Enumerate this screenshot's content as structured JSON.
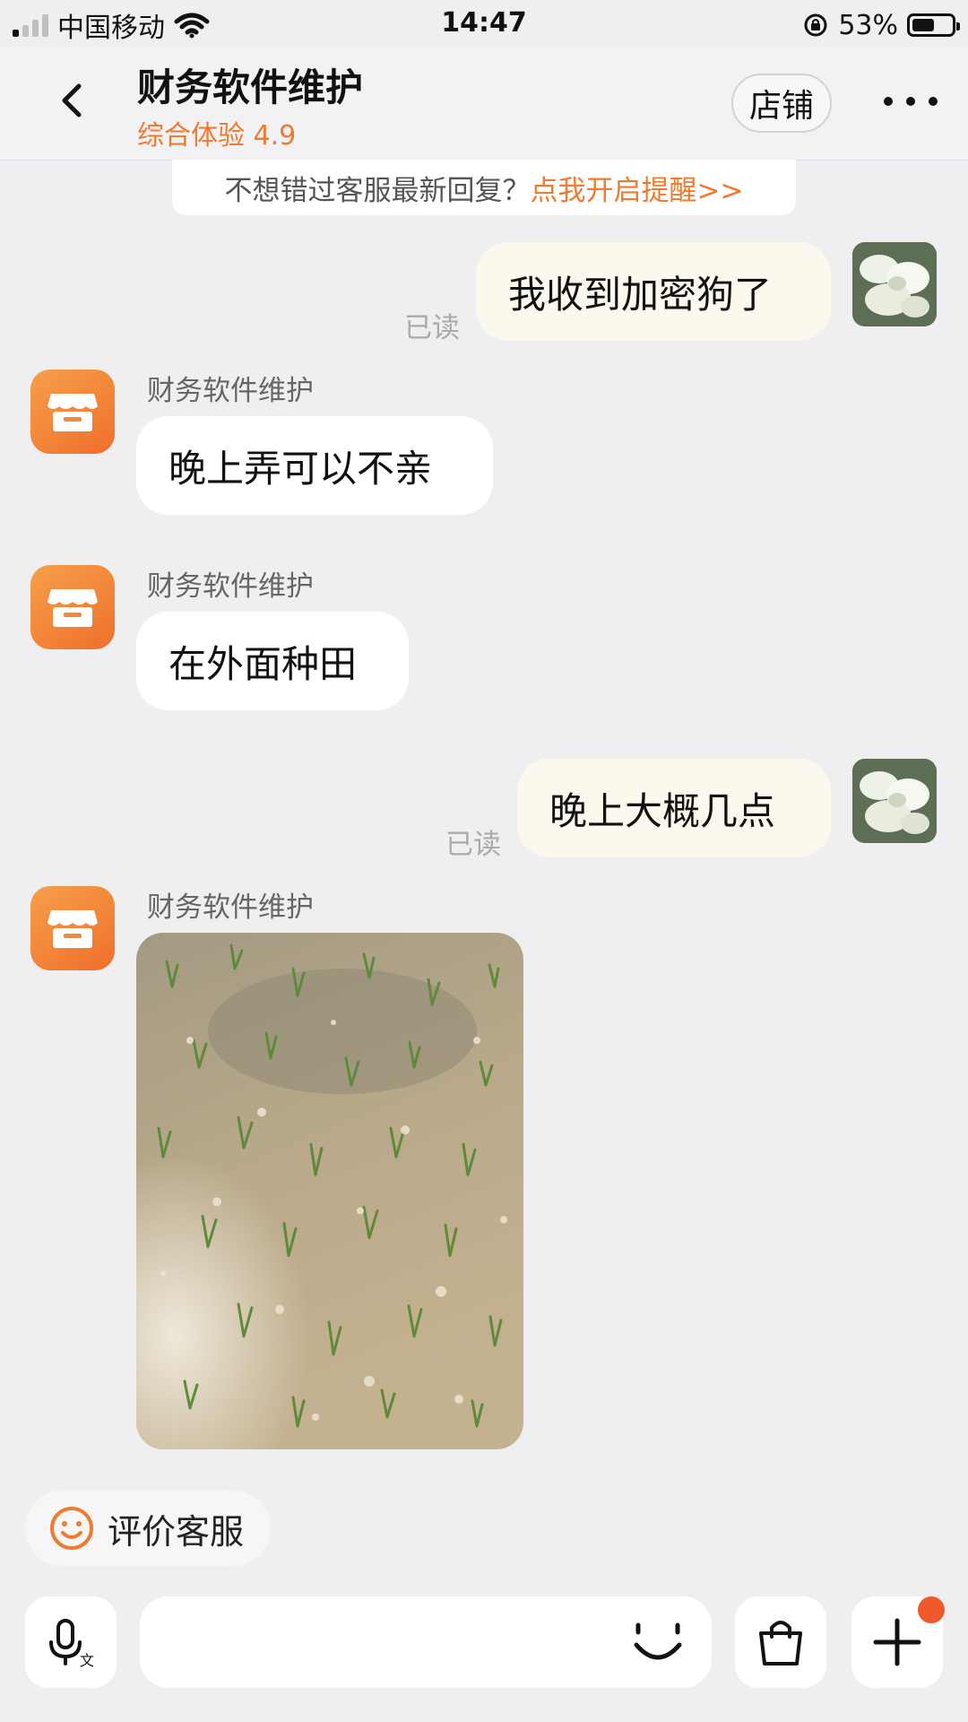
{
  "status_bar": {
    "carrier": "中国移动",
    "time": "14:47",
    "battery": "53%"
  },
  "header": {
    "title": "财务软件维护",
    "rating": "综合体验 4.9",
    "shop_label": "店铺"
  },
  "notice": {
    "text": "不想错过客服最新回复？",
    "link": "点我开启提醒>>"
  },
  "messages": [
    {
      "side": "out",
      "text": "我收到加密狗了",
      "status": "已读"
    },
    {
      "side": "in",
      "sender": "财务软件维护",
      "text": "晚上弄可以不亲"
    },
    {
      "side": "in",
      "sender": "财务软件维护",
      "text": "在外面种田"
    },
    {
      "side": "out",
      "text": "晚上大概几点",
      "status": "已读"
    },
    {
      "side": "in",
      "sender": "财务软件维护",
      "type": "image",
      "image_desc": "rice-paddy-photo"
    }
  ],
  "rate_button": {
    "label": "评价客服"
  },
  "colors": {
    "accent": "#f07a2e",
    "badge": "#f05a2a",
    "outgoing_bubble": "#fbf8ee"
  }
}
